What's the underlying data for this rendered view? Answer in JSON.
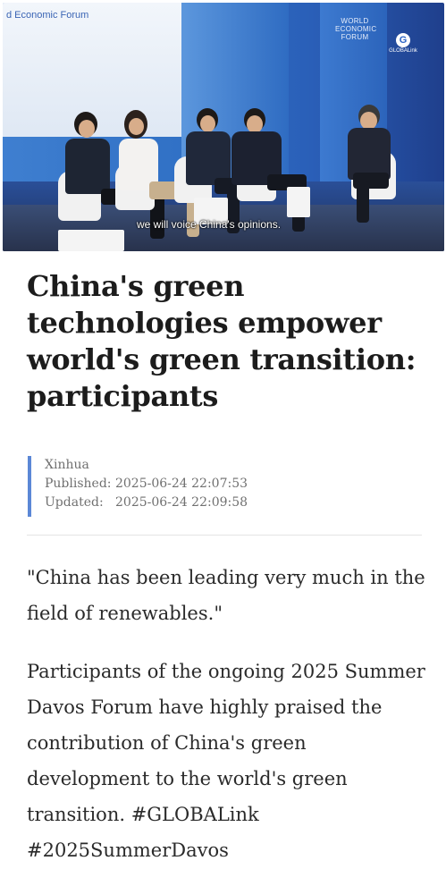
{
  "video": {
    "screen_label": "d Economic Forum",
    "wef_logo_lines": [
      "WORLD",
      "ECONOMIC",
      "FORUM"
    ],
    "globalink_icon": "globalink-logo",
    "globalink_text": "GLOBALink",
    "subtitle": "we will voice China's opinions."
  },
  "article": {
    "headline": "China's green technologies empower world's green transition: participants",
    "source": "Xinhua",
    "published": "Published: 2025-06-24 22:07:53",
    "updated": "Updated:   2025-06-24 22:09:58",
    "paragraphs": [
      "\"China has been leading very much in the field of renewables.\"",
      "Participants of the ongoing 2025 Summer Davos Forum have highly praised the contribution of China's green development to the world's green transition. #GLOBALink #2025SummerDavos"
    ]
  },
  "colors": {
    "accent_bar": "#5b87d6",
    "headline": "#1c1c1c",
    "meta_text": "#707070",
    "body_text": "#2a2a2a"
  }
}
